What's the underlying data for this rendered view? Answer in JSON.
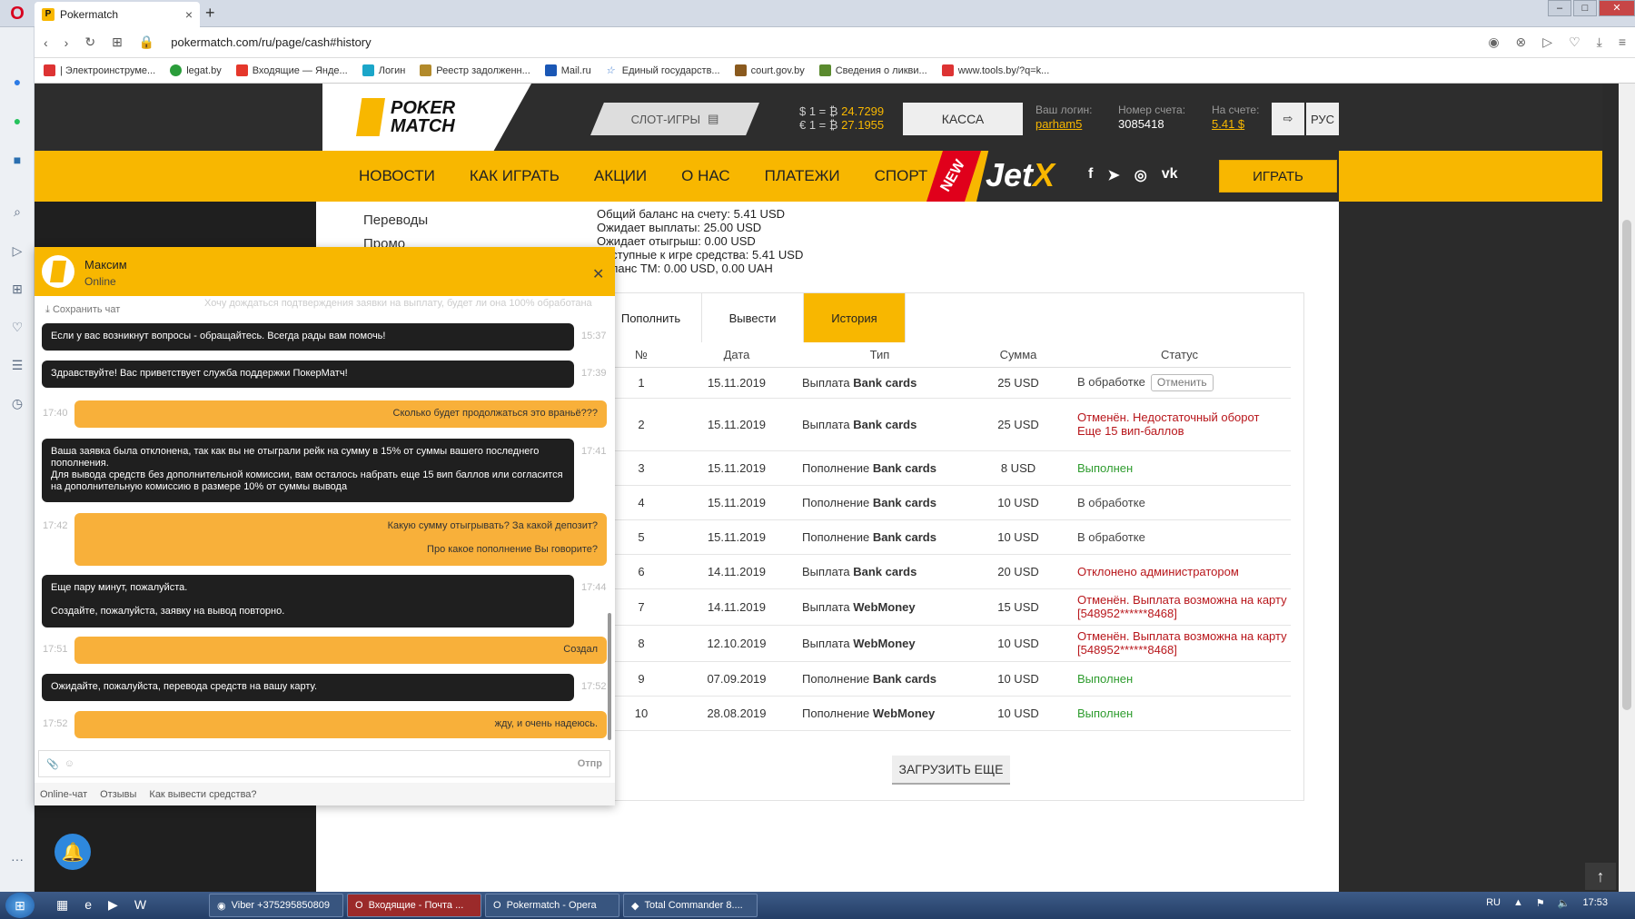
{
  "browser": {
    "tab_title": "Pokermatch",
    "tab_favicon": "P",
    "url": "pokermatch.com/ru/page/cash#history",
    "bookmarks": [
      "| Электроинструме...",
      "legat.by",
      "Входящие — Янде...",
      "Логин",
      "Реестр задолженн...",
      "Mail.ru",
      "Единый государств...",
      "court.gov.by",
      "Сведения о ликви...",
      "www.tools.by/?q=k..."
    ]
  },
  "header": {
    "logo_line1": "POKER",
    "logo_line2": "MATCH",
    "slots_label": "СЛОТ-ИГРЫ",
    "rate_usd": "$ 1 = ₿",
    "rate_usd_value": "24.7299",
    "rate_eur": "€ 1 = ₿",
    "rate_eur_value": "27.1955",
    "kassa_label": "КАССА",
    "login_label": "Ваш логин:",
    "login_value": "parham5",
    "account_label": "Номер счета:",
    "account_value": "3085418",
    "balance_label": "На счете:",
    "balance_value": "5.41 $",
    "lang_label": "РУС"
  },
  "nav": {
    "items": [
      "НОВОСТИ",
      "КАК ИГРАТЬ",
      "АКЦИИ",
      "О НАС",
      "ПЛАТЕЖИ",
      "СПОРТ"
    ],
    "new_badge": "NEW",
    "jetx_a": "Jet",
    "jetx_b": "X",
    "play_label": "ИГРАТЬ"
  },
  "submenu": [
    "Переводы",
    "Промо"
  ],
  "balance_info": [
    "Общий баланс на счету: 5.41 USD",
    "Ожидает выплаты: 25.00 USD",
    "Ожидает отыгрыш: 0.00 USD",
    "Доступные к игре средства: 5.41 USD",
    "Баланс TM: 0.00 USD, 0.00 UAH"
  ],
  "cash_tabs": [
    "Пополнить",
    "Вывести",
    "История"
  ],
  "history": {
    "headers": [
      "№",
      "Дата",
      "Тип",
      "Сумма",
      "Статус"
    ],
    "rows": [
      {
        "n": "1",
        "date": "15.11.2019",
        "type": "Выплата",
        "method": "Bank cards",
        "sum": "25 USD",
        "status": "В обработке",
        "status_kind": "gray",
        "action": "Отменить"
      },
      {
        "n": "2",
        "date": "15.11.2019",
        "type": "Выплата",
        "method": "Bank cards",
        "sum": "25 USD",
        "status": "Отменён. Недостаточный оборот\nЕще 15 вип-баллов",
        "status_kind": "red",
        "action": ""
      },
      {
        "n": "3",
        "date": "15.11.2019",
        "type": "Пополнение",
        "method": "Bank cards",
        "sum": "8 USD",
        "status": "Выполнен",
        "status_kind": "green",
        "action": ""
      },
      {
        "n": "4",
        "date": "15.11.2019",
        "type": "Пополнение",
        "method": "Bank cards",
        "sum": "10 USD",
        "status": "В обработке",
        "status_kind": "gray",
        "action": ""
      },
      {
        "n": "5",
        "date": "15.11.2019",
        "type": "Пополнение",
        "method": "Bank cards",
        "sum": "10 USD",
        "status": "В обработке",
        "status_kind": "gray",
        "action": ""
      },
      {
        "n": "6",
        "date": "14.11.2019",
        "type": "Выплата",
        "method": "Bank cards",
        "sum": "20 USD",
        "status": "Отклонено администратором",
        "status_kind": "red",
        "action": ""
      },
      {
        "n": "7",
        "date": "14.11.2019",
        "type": "Выплата",
        "method": "WebMoney",
        "sum": "15 USD",
        "status": "Отменён. Выплата возможна на карту [548952******8468]",
        "status_kind": "red",
        "action": ""
      },
      {
        "n": "8",
        "date": "12.10.2019",
        "type": "Выплата",
        "method": "WebMoney",
        "sum": "10 USD",
        "status": "Отменён. Выплата возможна на карту [548952******8468]",
        "status_kind": "red",
        "action": ""
      },
      {
        "n": "9",
        "date": "07.09.2019",
        "type": "Пополнение",
        "method": "Bank cards",
        "sum": "10 USD",
        "status": "Выполнен",
        "status_kind": "green",
        "action": ""
      },
      {
        "n": "10",
        "date": "28.08.2019",
        "type": "Пополнение",
        "method": "WebMoney",
        "sum": "10 USD",
        "status": "Выполнен",
        "status_kind": "green",
        "action": ""
      }
    ],
    "load_more": "ЗАГРУЗИТЬ ЕЩЕ"
  },
  "chat": {
    "agent_name": "Максим",
    "agent_status": "Online",
    "save_chat": "Сохранить чат",
    "faded_text": "Хочу дождаться подтверждения заявки на выплату, будет ли она 100% обработана",
    "messages": [
      {
        "from": "op",
        "time": "15:37",
        "text": "Если у вас возникнут вопросы - обращайтесь. Всегда рады вам помочь!"
      },
      {
        "from": "op",
        "time": "17:39",
        "text": "Здравствуйте! Вас приветствует служба поддержки ПокерМатч!"
      },
      {
        "from": "me",
        "time": "17:40",
        "text": "Сколько будет продолжаться это враньё???"
      },
      {
        "from": "op",
        "time": "17:41",
        "text": "Ваша заявка была отклонена, так как вы не отыграли рейк на сумму в 15% от суммы вашего последнего пополнения.\nДля вывода средств без дополнительной комиссии, вам осталось набрать еще 15 вип баллов или согласится на дополнительную комиссию в размере 10% от суммы вывода"
      },
      {
        "from": "me",
        "time": "17:42",
        "text": "Какую сумму отыгрывать? За какой депозит?\n\nПро какое пополнение Вы говорите?"
      },
      {
        "from": "op",
        "time": "17:44",
        "text": "Еще пару минут, пожалуйста.\n\nСоздайте, пожалуйста, заявку на вывод повторно."
      },
      {
        "from": "me",
        "time": "17:51",
        "text": "Создал"
      },
      {
        "from": "op",
        "time": "17:52",
        "text": "Ожидайте, пожалуйста, перевода средств на вашу карту."
      },
      {
        "from": "me",
        "time": "17:52",
        "text": "жду, и очень надеюсь."
      }
    ],
    "send_label": "Отпр",
    "tabs": [
      "Online-чат",
      "Отзывы",
      "Как вывести средства?"
    ]
  },
  "taskbar": {
    "tasks": [
      "Viber +375295850809",
      "Входящие - Почта ...",
      "Pokermatch - Opera",
      "Total Commander 8...."
    ],
    "lang": "RU",
    "time": "17:53"
  },
  "colors": {
    "brand_yellow": "#f8b700",
    "status_green": "#2e9c2e",
    "status_red": "#b8161b",
    "dark": "#2d2d2d"
  }
}
